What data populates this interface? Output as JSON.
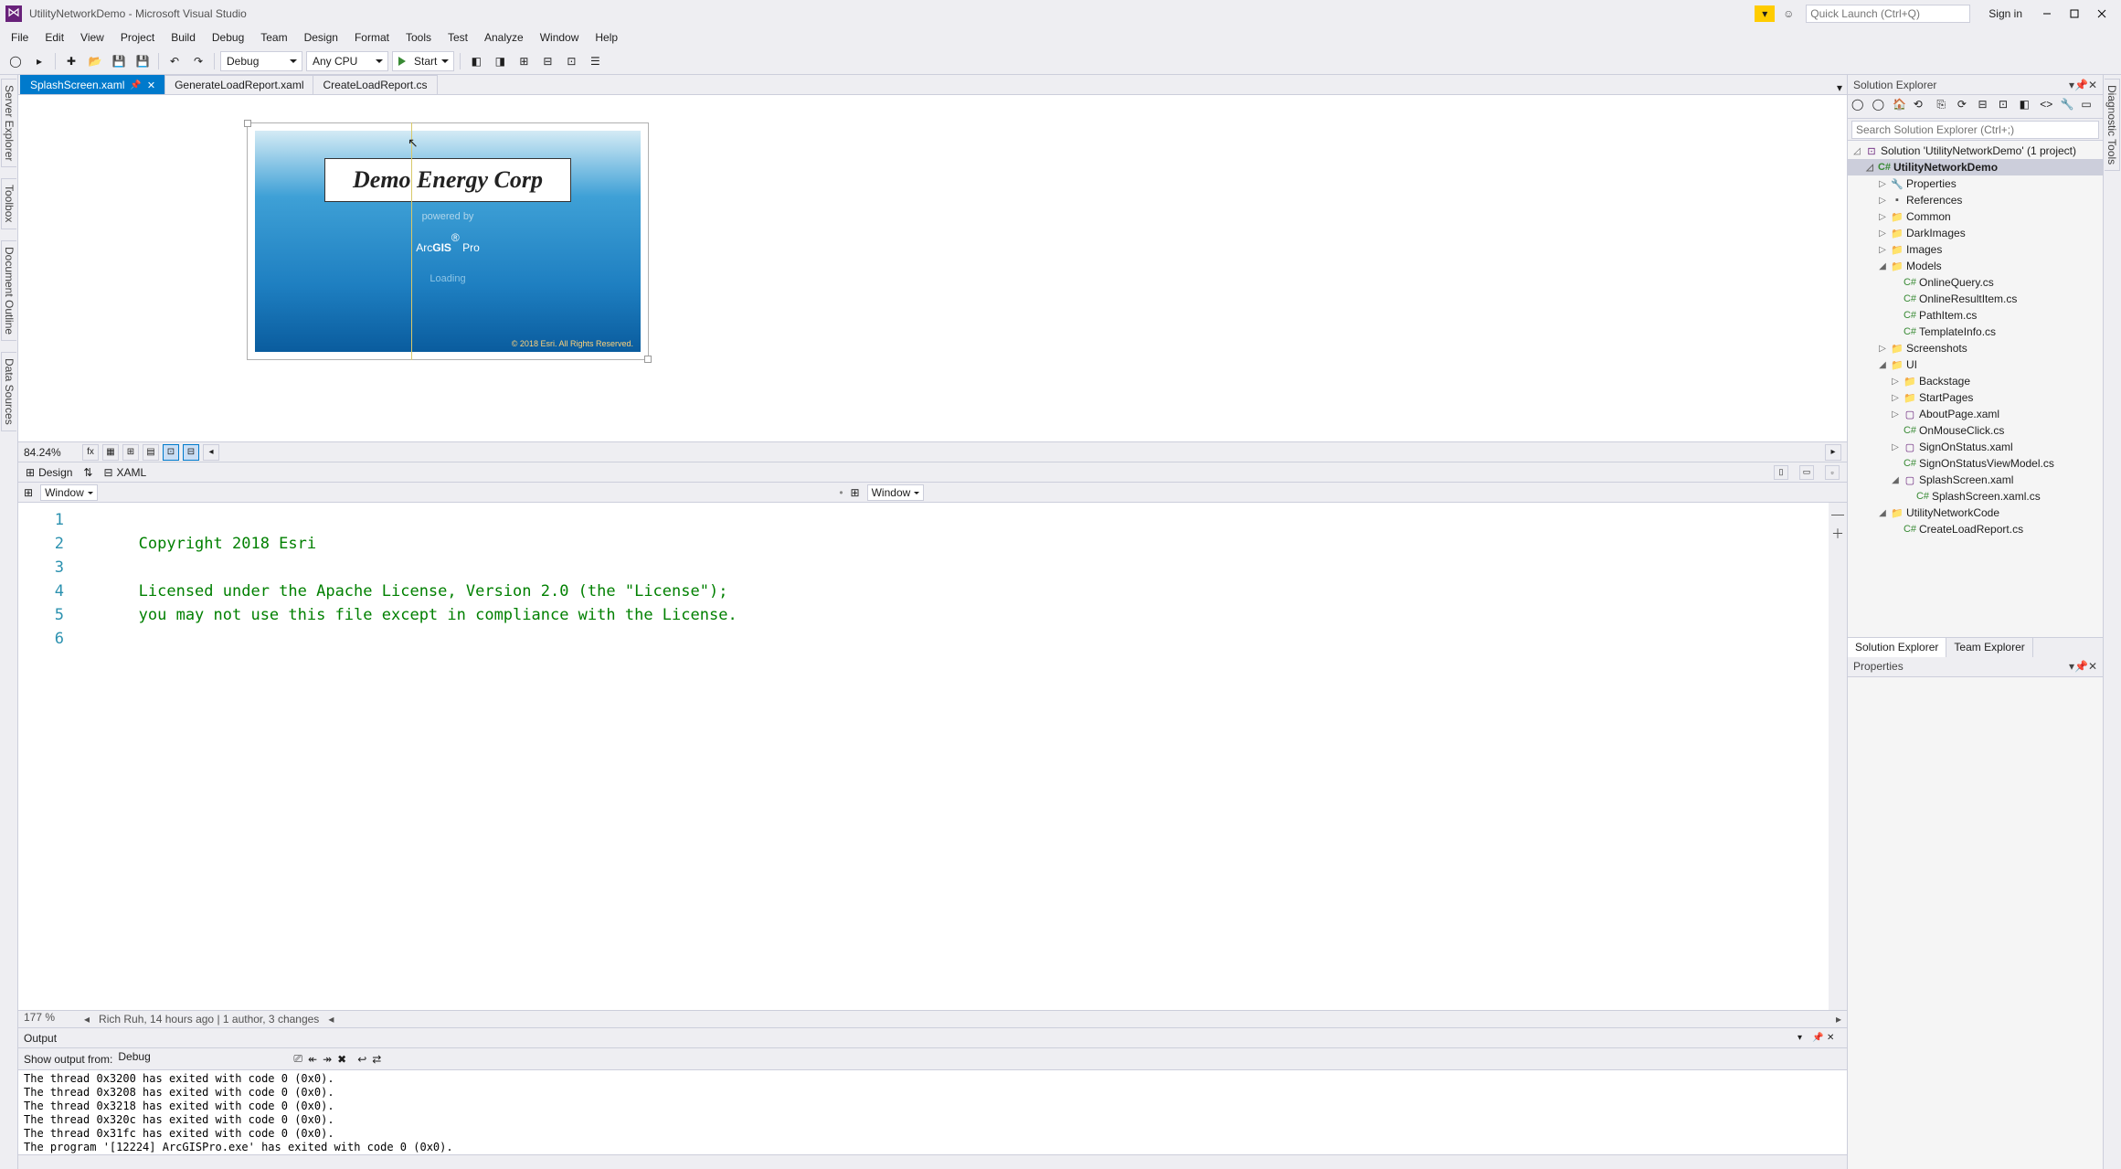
{
  "title": "UtilityNetworkDemo - Microsoft Visual Studio",
  "quick_launch_placeholder": "Quick Launch (Ctrl+Q)",
  "signin": "Sign in",
  "menus": [
    "File",
    "Edit",
    "View",
    "Project",
    "Build",
    "Debug",
    "Team",
    "Design",
    "Format",
    "Tools",
    "Test",
    "Analyze",
    "Window",
    "Help"
  ],
  "toolbar": {
    "config": "Debug",
    "platform": "Any CPU",
    "start": "Start"
  },
  "doc_tabs": [
    {
      "label": "SplashScreen.xaml",
      "active": true,
      "pinned": true,
      "closable": true
    },
    {
      "label": "GenerateLoadReport.xaml",
      "active": false
    },
    {
      "label": "CreateLoadReport.cs",
      "active": false
    }
  ],
  "designer": {
    "company": "Demo Energy Corp",
    "powered": "powered by",
    "arcgis_pre": "Arc",
    "arcgis_bold": "GIS",
    "arcgis_reg": "®",
    "arcgis_post": " Pro",
    "loading": "Loading",
    "copyright": "© 2018 Esri. All Rights Reserved.",
    "zoom": "84.24%"
  },
  "dxaml": {
    "design": "Design",
    "xaml": "XAML",
    "swap": "⇅"
  },
  "breadcrumb": {
    "b1": "Window",
    "b2": "Window"
  },
  "code": {
    "lines": [
      "<!--",
      "",
      "   Copyright 2018 Esri",
      "",
      "   Licensed under the Apache License, Version 2.0 (the \"License\");",
      "   you may not use this file except in compliance with the License."
    ],
    "status_zoom": "177 %",
    "status_author": "Rich Ruh, 14 hours ago | 1 author, 3 changes"
  },
  "output": {
    "title": "Output",
    "show_label": "Show output from:",
    "show_value": "Debug",
    "lines": [
      "The thread 0x3200 has exited with code 0 (0x0).",
      "The thread 0x3208 has exited with code 0 (0x0).",
      "The thread 0x3218 has exited with code 0 (0x0).",
      "The thread 0x320c has exited with code 0 (0x0).",
      "The thread 0x31fc has exited with code 0 (0x0).",
      "The program '[12224] ArcGISPro.exe' has exited with code 0 (0x0)."
    ]
  },
  "left_tabs": [
    "Server Explorer",
    "Toolbox",
    "Document Outline",
    "Data Sources"
  ],
  "right_tab": "Diagnostic Tools",
  "solution_explorer": {
    "title": "Solution Explorer",
    "search_placeholder": "Search Solution Explorer (Ctrl+;)",
    "root": "Solution 'UtilityNetworkDemo' (1 project)",
    "project": "UtilityNetworkDemo",
    "nodes": [
      {
        "depth": 1,
        "exp": "▷",
        "ico": "wrench",
        "label": "Properties"
      },
      {
        "depth": 1,
        "exp": "▷",
        "ico": "ref",
        "label": "References"
      },
      {
        "depth": 1,
        "exp": "▷",
        "ico": "folder",
        "label": "Common"
      },
      {
        "depth": 1,
        "exp": "▷",
        "ico": "folder",
        "label": "DarkImages"
      },
      {
        "depth": 1,
        "exp": "▷",
        "ico": "folder",
        "label": "Images"
      },
      {
        "depth": 1,
        "exp": "◿",
        "ico": "folder",
        "label": "Models"
      },
      {
        "depth": 2,
        "exp": "",
        "ico": "cs",
        "label": "OnlineQuery.cs"
      },
      {
        "depth": 2,
        "exp": "",
        "ico": "cs",
        "label": "OnlineResultItem.cs"
      },
      {
        "depth": 2,
        "exp": "",
        "ico": "cs",
        "label": "PathItem.cs"
      },
      {
        "depth": 2,
        "exp": "",
        "ico": "cs",
        "label": "TemplateInfo.cs"
      },
      {
        "depth": 1,
        "exp": "▷",
        "ico": "folder",
        "label": "Screenshots"
      },
      {
        "depth": 1,
        "exp": "◿",
        "ico": "folder",
        "label": "UI"
      },
      {
        "depth": 2,
        "exp": "▷",
        "ico": "folder",
        "label": "Backstage"
      },
      {
        "depth": 2,
        "exp": "▷",
        "ico": "folder",
        "label": "StartPages"
      },
      {
        "depth": 2,
        "exp": "▷",
        "ico": "xaml",
        "label": "AboutPage.xaml"
      },
      {
        "depth": 2,
        "exp": "",
        "ico": "cs",
        "label": "OnMouseClick.cs"
      },
      {
        "depth": 2,
        "exp": "▷",
        "ico": "xaml",
        "label": "SignOnStatus.xaml"
      },
      {
        "depth": 2,
        "exp": "",
        "ico": "cs",
        "label": "SignOnStatusViewModel.cs"
      },
      {
        "depth": 2,
        "exp": "◿",
        "ico": "xaml",
        "label": "SplashScreen.xaml"
      },
      {
        "depth": 3,
        "exp": "",
        "ico": "cs",
        "label": "SplashScreen.xaml.cs"
      },
      {
        "depth": 1,
        "exp": "◿",
        "ico": "folder",
        "label": "UtilityNetworkCode"
      },
      {
        "depth": 2,
        "exp": "",
        "ico": "cs",
        "label": "CreateLoadReport.cs"
      }
    ],
    "tabs": [
      "Solution Explorer",
      "Team Explorer"
    ]
  },
  "properties": {
    "title": "Properties"
  }
}
